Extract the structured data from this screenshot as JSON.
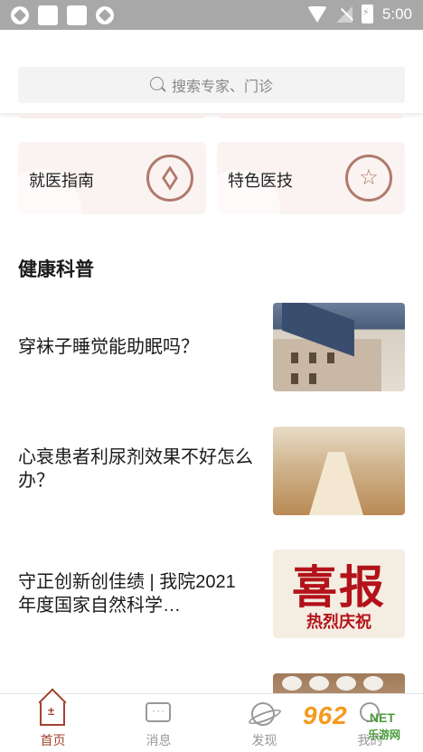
{
  "status_bar": {
    "time": "5:00",
    "icons": [
      "app-icon",
      "notification-icon",
      "notification-icon",
      "app-icon",
      "wifi-icon",
      "no-signal-icon",
      "battery-charging-icon"
    ]
  },
  "search": {
    "placeholder": "搜索专家、门诊"
  },
  "quick_cards": [
    {
      "label": "就医指南",
      "icon": "compass-icon"
    },
    {
      "label": "特色医技",
      "icon": "star-icon"
    }
  ],
  "section": {
    "title": "健康科普"
  },
  "articles": [
    {
      "title": "穿袜子睡觉能助眠吗？",
      "thumb": "hospital-building-photo"
    },
    {
      "title": "心衰患者利尿剂效果不好怎么办？",
      "thumb": "hospital-hallway-photo"
    },
    {
      "title": "守正创新创佳绩 | 我院2021年度国家自然科学…",
      "thumb": "celebration-poster",
      "thumb_text_big": "喜报",
      "thumb_text_small": "热烈庆祝"
    },
    {
      "title": "",
      "thumb": "eggs-photo"
    }
  ],
  "bottom_nav": [
    {
      "label": "首页",
      "icon": "home-icon",
      "active": true
    },
    {
      "label": "消息",
      "icon": "message-icon",
      "active": false
    },
    {
      "label": "发现",
      "icon": "planet-icon",
      "active": false
    },
    {
      "label": "我的",
      "icon": "user-icon",
      "active": false
    }
  ],
  "watermark": {
    "brand": "962",
    "suffix": ".NET",
    "subtitle": "乐游网"
  },
  "colors": {
    "accent": "#a0442f",
    "card_bg": "#fbf3f1",
    "status_bar": "#a8a8a8"
  }
}
